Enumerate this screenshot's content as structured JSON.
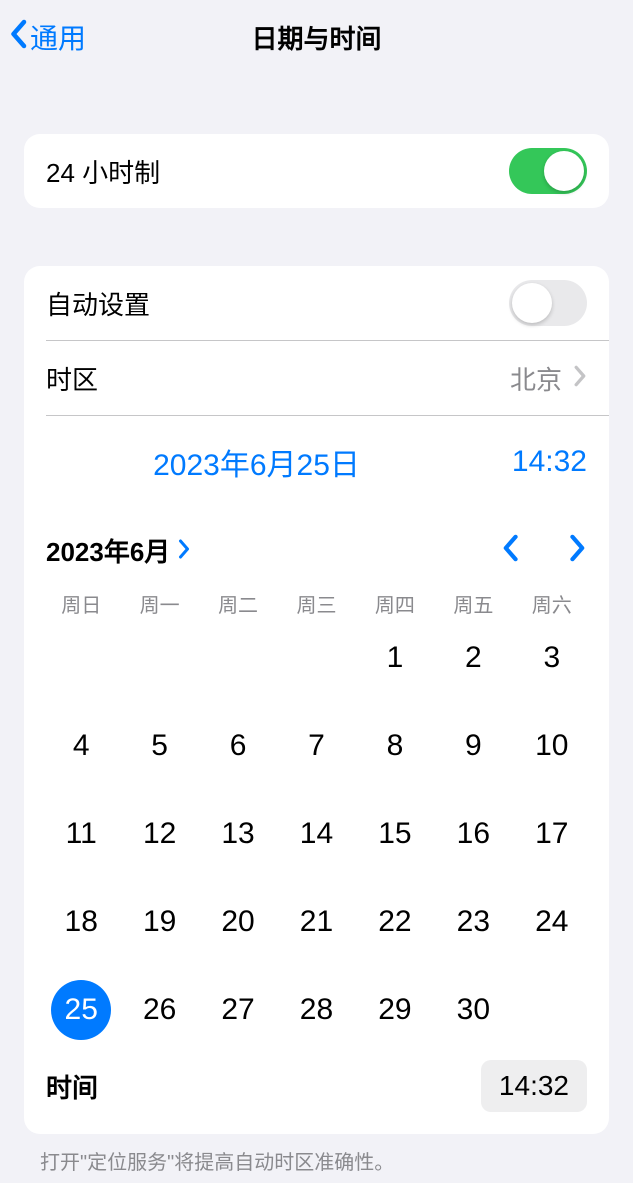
{
  "nav": {
    "back_label": "通用",
    "title": "日期与时间"
  },
  "settings": {
    "twenty_four_hour_label": "24 小时制",
    "twenty_four_hour_on": true,
    "auto_set_label": "自动设置",
    "auto_set_on": false,
    "timezone_label": "时区",
    "timezone_value": "北京"
  },
  "summary": {
    "date": "2023年6月25日",
    "time": "14:32"
  },
  "calendar": {
    "month_label": "2023年6月",
    "weekdays": [
      "周日",
      "周一",
      "周二",
      "周三",
      "周四",
      "周五",
      "周六"
    ],
    "leading_blanks": 4,
    "days_in_month": 30,
    "selected_day": 25
  },
  "time_row": {
    "label": "时间",
    "value": "14:32"
  },
  "footer_note": "打开\"定位服务\"将提高自动时区准确性。"
}
